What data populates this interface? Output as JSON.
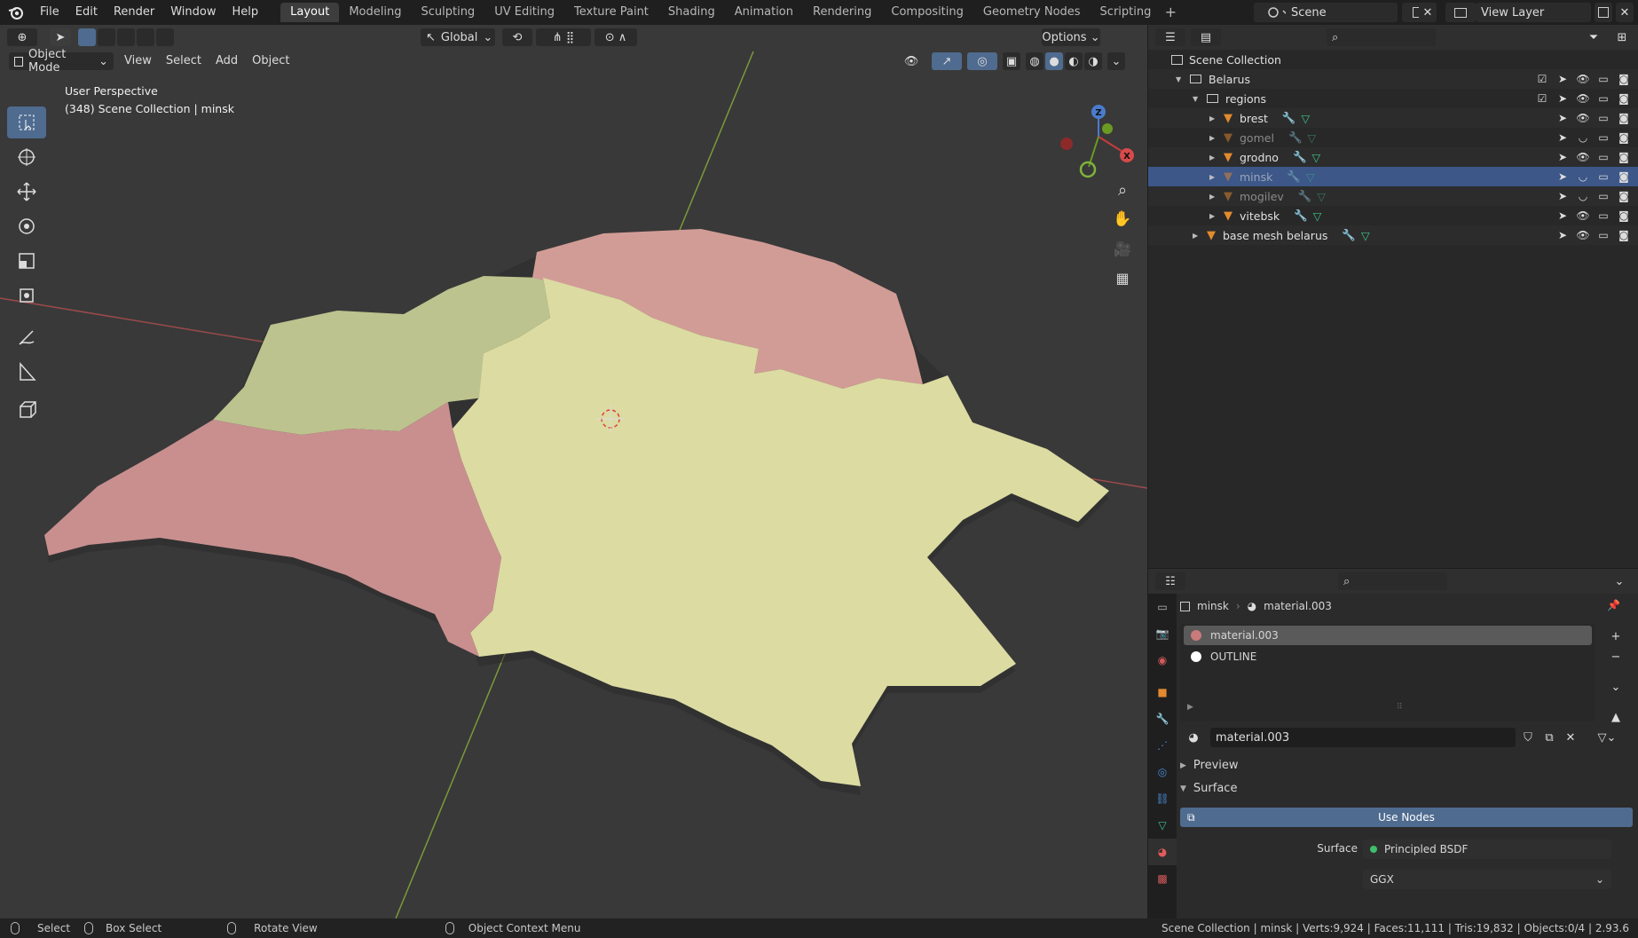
{
  "topbar": {
    "menus": [
      "File",
      "Edit",
      "Render",
      "Window",
      "Help"
    ],
    "workspaces": [
      "Layout",
      "Modeling",
      "Sculpting",
      "UV Editing",
      "Texture Paint",
      "Shading",
      "Animation",
      "Rendering",
      "Compositing",
      "Geometry Nodes",
      "Scripting"
    ],
    "active_workspace": "Layout",
    "scene": "Scene",
    "view_layer": "View Layer"
  },
  "viewport": {
    "transform_orientation": "Global",
    "options_label": "Options",
    "mode": "Object Mode",
    "menus": [
      "View",
      "Select",
      "Add",
      "Object"
    ],
    "info_line1": "User Perspective",
    "info_line2": "(348) Scene Collection | minsk",
    "gizmo_axes": [
      "X",
      "Y",
      "Z"
    ]
  },
  "outliner": {
    "root": "Scene Collection",
    "items": [
      {
        "name": "Belarus",
        "kind": "collection",
        "depth": 1
      },
      {
        "name": "regions",
        "kind": "collection",
        "depth": 2
      },
      {
        "name": "brest",
        "kind": "mesh",
        "depth": 3,
        "visible": true
      },
      {
        "name": "gomel",
        "kind": "mesh",
        "depth": 3,
        "visible": false
      },
      {
        "name": "grodno",
        "kind": "mesh",
        "depth": 3,
        "visible": true
      },
      {
        "name": "minsk",
        "kind": "mesh",
        "depth": 3,
        "visible": false,
        "selected": true
      },
      {
        "name": "mogilev",
        "kind": "mesh",
        "depth": 3,
        "visible": false
      },
      {
        "name": "vitebsk",
        "kind": "mesh",
        "depth": 3,
        "visible": true
      },
      {
        "name": "base mesh belarus",
        "kind": "mesh",
        "depth": 2,
        "visible": true
      }
    ]
  },
  "properties": {
    "object": "minsk",
    "material": "material.003",
    "slots": [
      "material.003",
      "OUTLINE"
    ],
    "slot_colors": [
      "#c97a7a",
      "#ffffff"
    ],
    "material_field": "material.003",
    "preview_label": "Preview",
    "surface_label": "Surface",
    "use_nodes_label": "Use Nodes",
    "surface_field_label": "Surface",
    "surface_value": "Principled BSDF",
    "distribution": "GGX"
  },
  "statusbar": {
    "select": "Select",
    "box_select": "Box Select",
    "rotate": "Rotate View",
    "context": "Object Context Menu",
    "stats": "Scene Collection | minsk | Verts:9,924 | Faces:11,111 | Tris:19,832 | Objects:0/4 | 2.93.6"
  },
  "colors": {
    "accent": "#4f6b8f",
    "selected_row": "#3c5788",
    "region_pink": "#c98f8f",
    "region_green": "#b9c48d",
    "region_yellow": "#dedca4"
  }
}
